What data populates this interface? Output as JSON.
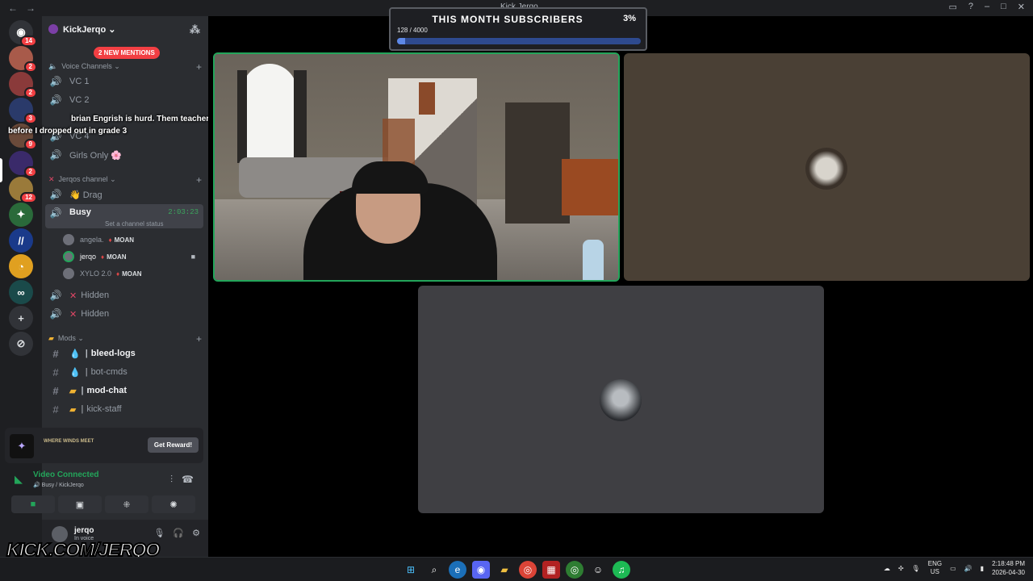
{
  "window": {
    "title": "Kick Jerqo",
    "back_icon": "←",
    "forward_icon": "→"
  },
  "rail": {
    "badges": [
      "14",
      "2",
      "2",
      "3",
      "9",
      "2",
      "12"
    ]
  },
  "server": {
    "name": "KickJerqo ⌄",
    "mentions": "2 NEW MENTIONS"
  },
  "categories": {
    "voice": "Voice Channels ⌄",
    "jerqos": "Jerqos channel ⌄",
    "mods": "Mods ⌄"
  },
  "channels": {
    "vc1": "VC 1",
    "vc2": "VC 2",
    "vc4": "VC 4",
    "girls": "Girls Only 🌸",
    "drag": "👋 Drag",
    "busy": "Busy",
    "busy_time": "2:03:23",
    "busy_status": "Set a channel status",
    "hidden1": "Hidden",
    "hidden2": "Hidden",
    "bleed": "bleed-logs",
    "botcmds": "bot-cmds",
    "modchat": "mod-chat",
    "kickstaff": "kick-staff"
  },
  "voice_users": [
    {
      "name": "angela.",
      "tag": "MOAN"
    },
    {
      "name": "jerqo",
      "tag": "MOAN"
    },
    {
      "name": "XYLO 2.0",
      "tag": "MOAN"
    }
  ],
  "overlay_chat": {
    "line1": "brian Engrish is hurd. Them teachers did not learn me nothing",
    "line2": "before I dropped out in grade 3"
  },
  "reward": {
    "game_text": "WHERE WINDS MEET",
    "button": "Get Reward!"
  },
  "voice_panel": {
    "status": "Video Connected",
    "location": "Busy / KickJerqo"
  },
  "user": {
    "name": "jerqo",
    "status": "In voice"
  },
  "stream_overlay": {
    "kick": "KICK.COM/JERQO"
  },
  "goal": {
    "title": "THIS MONTH SUBSCRIBERS",
    "percent": "3%",
    "count": "128 / 4000",
    "progress": 0.032
  },
  "taskbar": {
    "lang": "ENG",
    "region": "US",
    "time": "2:18:48 PM",
    "date": "2026-04-30"
  },
  "colors": {
    "accent_green": "#23a55a",
    "mention_red": "#f23f43",
    "kick_green": "#53fc18"
  }
}
